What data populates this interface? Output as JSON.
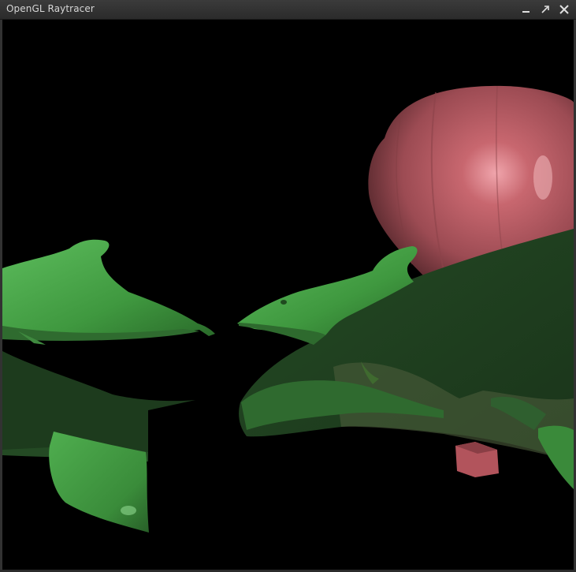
{
  "window": {
    "title": "OpenGL Raytracer",
    "controls": [
      "minimize-icon",
      "maximize-icon",
      "close-icon"
    ]
  },
  "scene": {
    "background": "#000000",
    "colors": {
      "dolphin_bright": "#4ea84e",
      "dolphin_mid": "#3a8a3a",
      "dolphin_dark": "#1f3f1f",
      "balloon": "#b65a63",
      "balloon_highlight": "#e79aa1",
      "basket": "#b2545c"
    }
  }
}
